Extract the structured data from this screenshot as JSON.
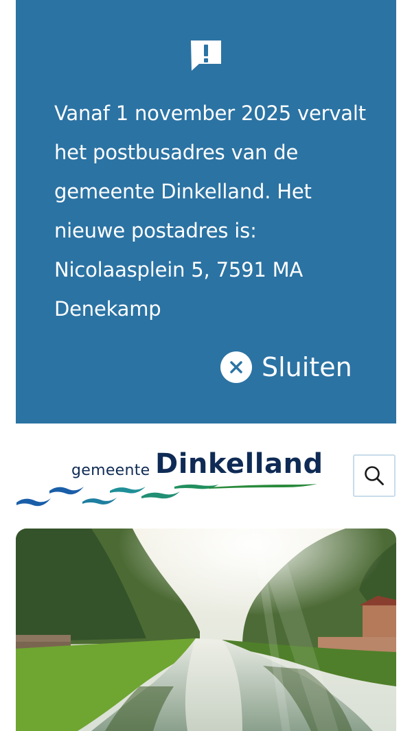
{
  "notice": {
    "icon": "message-alert-icon",
    "text": "Vanaf 1 november 2025 vervalt het postbusadres van de gemeente Dinkelland. Het nieuwe postadres is: Nicolaasplein 5, 7591 MA Denekamp",
    "close_label": "Sluiten",
    "background_color": "#2b73a3"
  },
  "header": {
    "logo": {
      "prefix": "gemeente",
      "name": "Dinkelland",
      "color": "#0f2b55"
    },
    "search_icon": "search-icon"
  },
  "hero": {
    "image": "canal-landscape-photo"
  }
}
